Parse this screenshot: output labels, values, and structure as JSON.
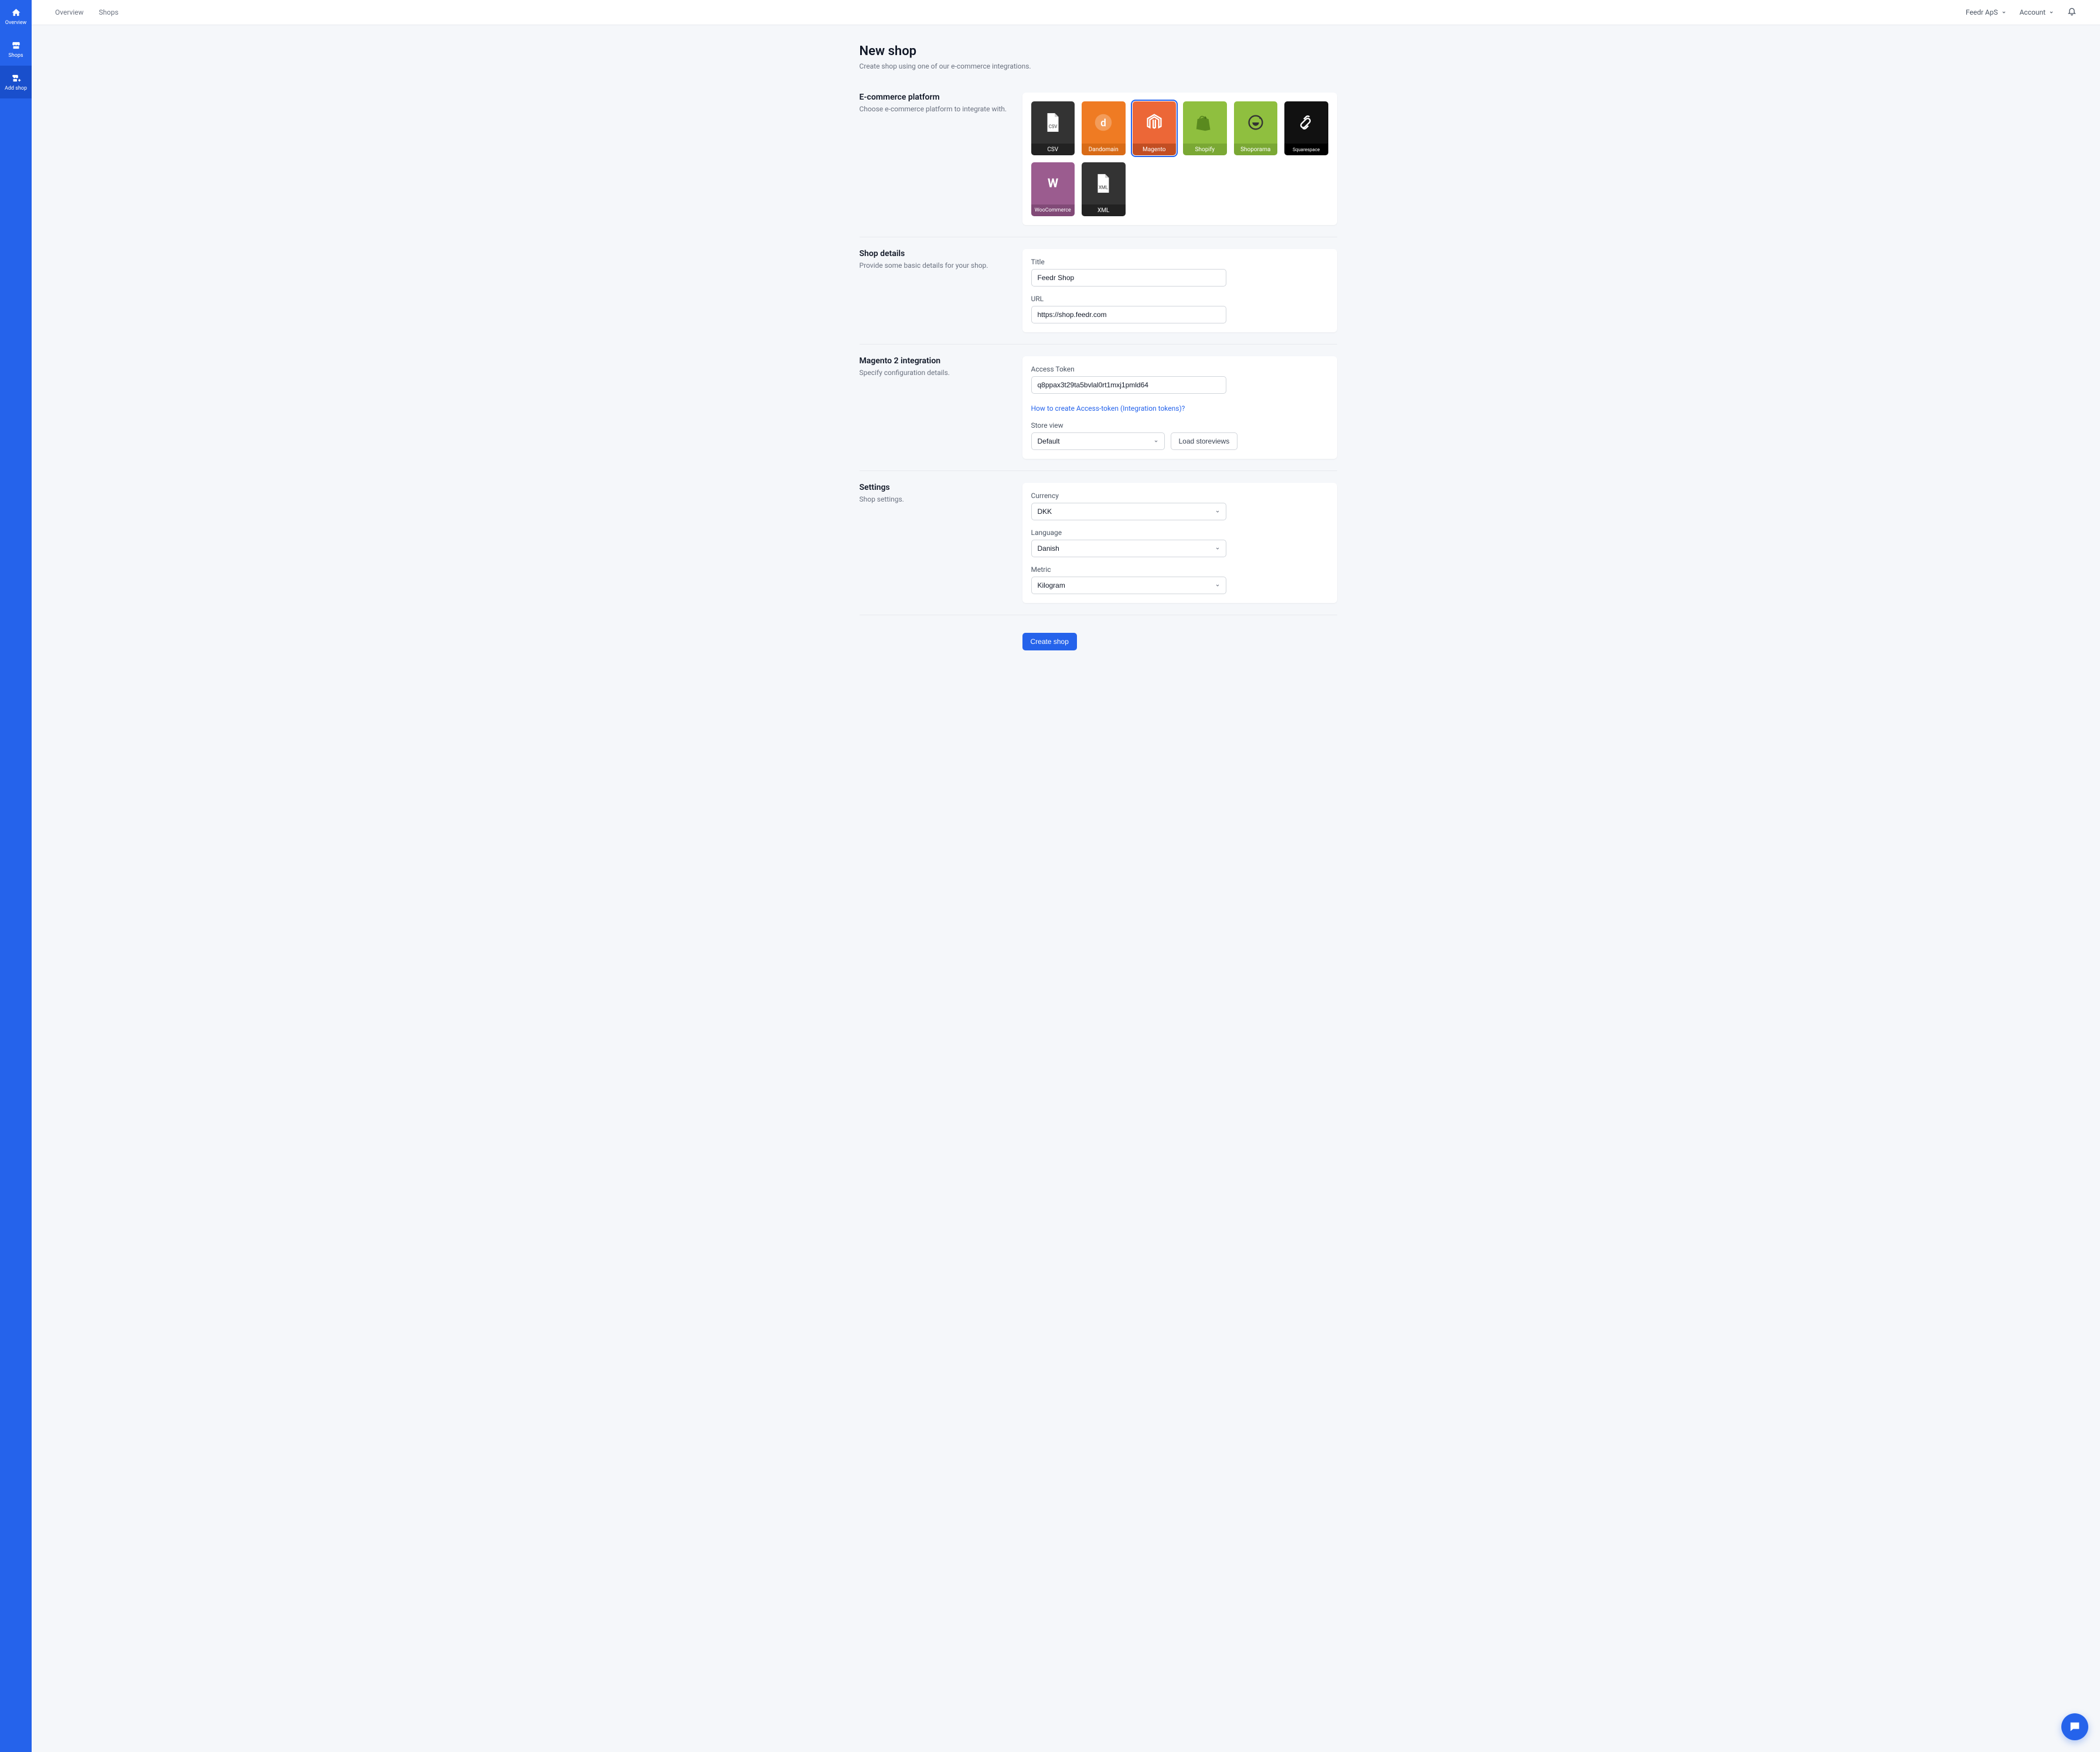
{
  "sidebar": {
    "items": [
      {
        "label": "Overview"
      },
      {
        "label": "Shops"
      },
      {
        "label": "Add shop"
      }
    ]
  },
  "topbar": {
    "links": {
      "overview": "Overview",
      "shops": "Shops"
    },
    "org": "Feedr ApS",
    "account": "Account"
  },
  "page": {
    "title": "New shop",
    "subtitle": "Create shop using one of our e-commerce integrations."
  },
  "platform_section": {
    "title": "E-commerce platform",
    "subtitle": "Choose e-commerce platform to integrate with.",
    "selected": "Magento",
    "tiles": {
      "csv": "CSV",
      "dd": "Dandomain",
      "mg": "Magento",
      "sp": "Shopify",
      "sh": "Shoporama",
      "sq": "Squarespace",
      "wc": "WooCommerce",
      "xml": "XML"
    }
  },
  "shop_section": {
    "title": "Shop details",
    "subtitle": "Provide some basic details for your shop.",
    "title_label": "Title",
    "title_value": "Feedr Shop",
    "url_label": "URL",
    "url_value": "https://shop.feedr.com"
  },
  "integration_section": {
    "title": "Magento 2 integration",
    "subtitle": "Specify configuration details.",
    "token_label": "Access Token",
    "token_value": "q8ppax3t29ta5bvlal0rt1mxj1pmld64",
    "help_link": "How to create Access-token (Integration tokens)?",
    "storeview_label": "Store view",
    "storeview_value": "Default",
    "load_btn": "Load storeviews"
  },
  "settings_section": {
    "title": "Settings",
    "subtitle": "Shop settings.",
    "currency_label": "Currency",
    "currency_value": "DKK",
    "language_label": "Language",
    "language_value": "Danish",
    "metric_label": "Metric",
    "metric_value": "Kilogram"
  },
  "footer": {
    "create_btn": "Create shop"
  }
}
